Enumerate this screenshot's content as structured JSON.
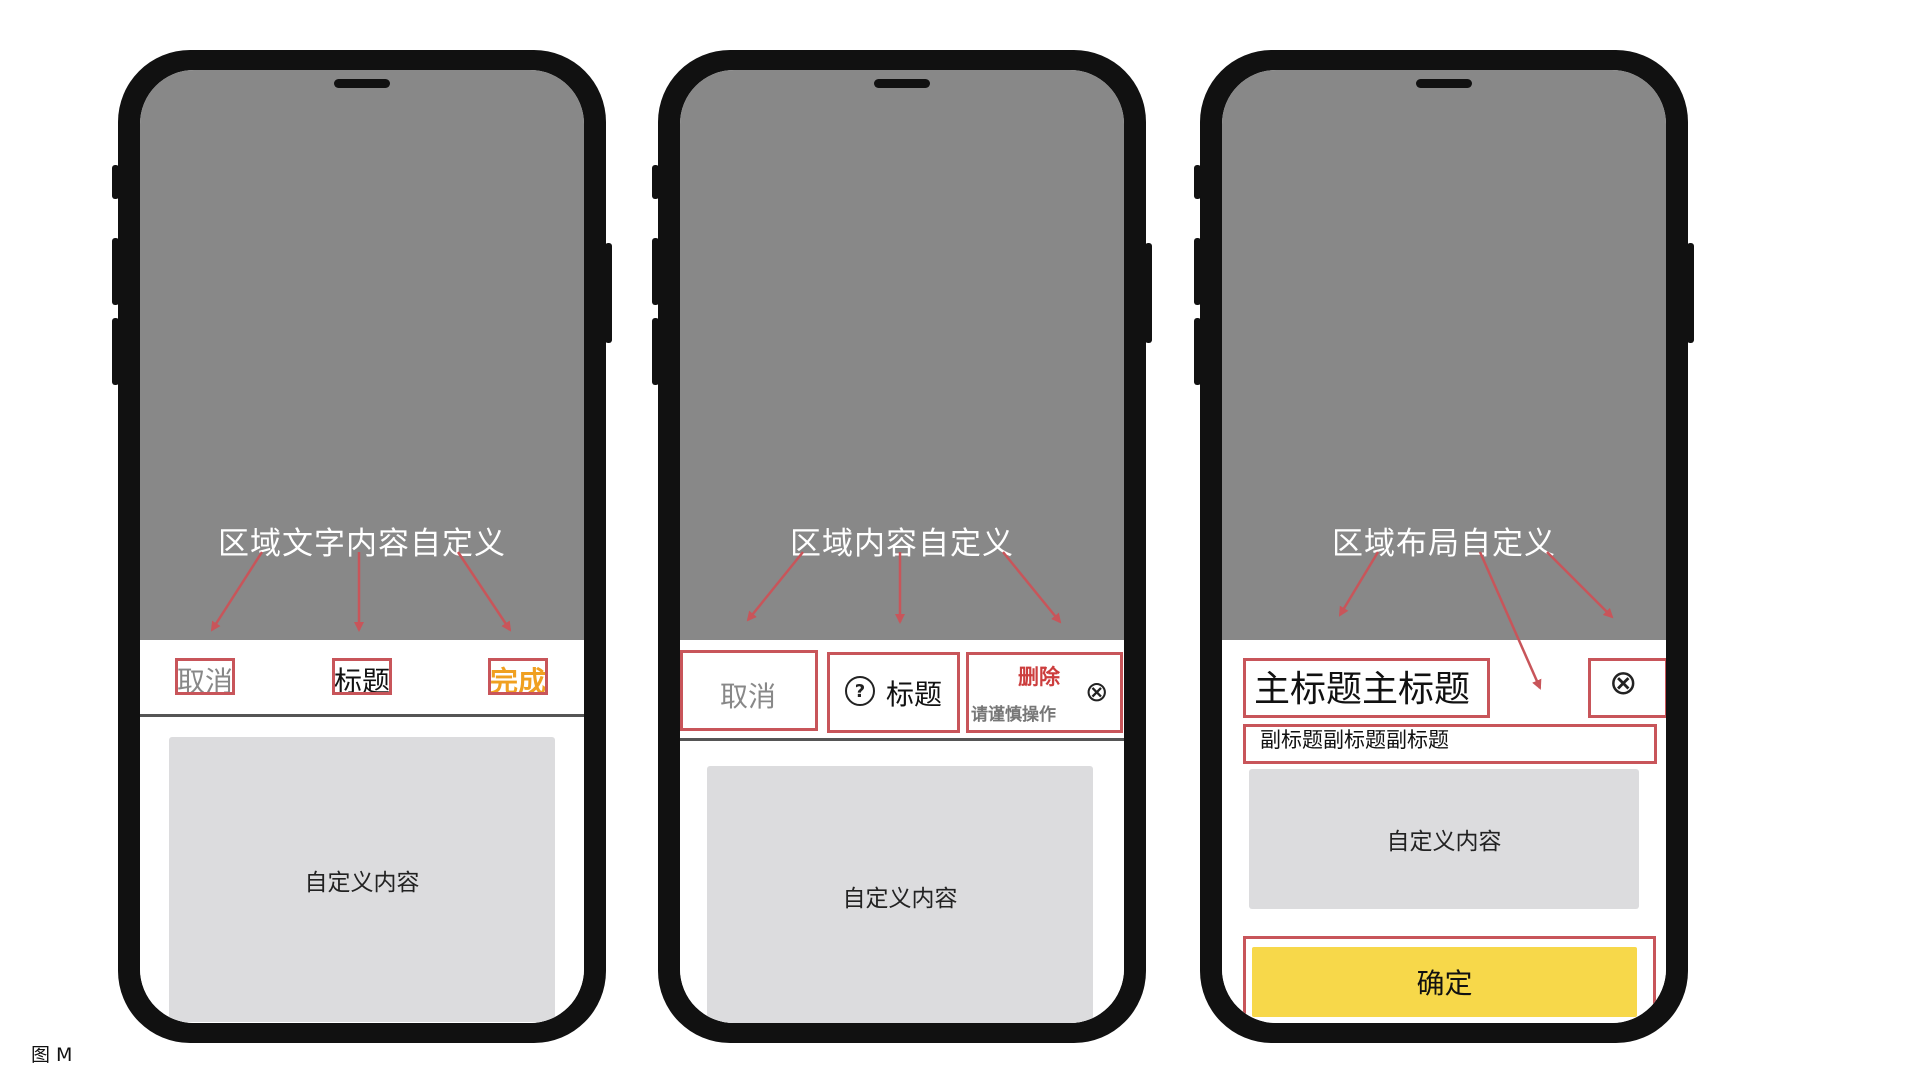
{
  "figure_label": "图 M",
  "phone1": {
    "region_label": "区域文字内容自定义",
    "cancel": "取消",
    "title": "标题",
    "done": "完成",
    "content": "自定义内容"
  },
  "phone2": {
    "region_label": "区域内容自定义",
    "cancel": "取消",
    "help_icon": "?",
    "title": "标题",
    "delete": "删除",
    "delete_hint": "请谨慎操作",
    "close_icon": "⊗",
    "content": "自定义内容"
  },
  "phone3": {
    "region_label": "区域布局自定义",
    "main_title": "主标题主标题",
    "close_icon": "⊗",
    "subtitle": "副标题副标题副标题",
    "content": "自定义内容",
    "confirm": "确定"
  },
  "colors": {
    "annotation_red": "#c8555a",
    "done_orange": "#f0a020",
    "delete_red": "#cc3d3d",
    "confirm_yellow": "#f7d84a",
    "content_gray": "#dcdcde",
    "screen_gray": "#888888"
  }
}
